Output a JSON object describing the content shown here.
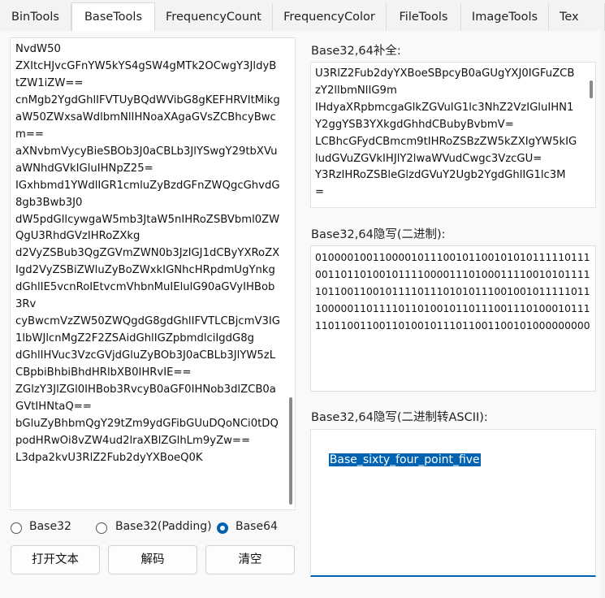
{
  "tabs": [
    {
      "label": "BinTools",
      "active": false
    },
    {
      "label": "BaseTools",
      "active": true
    },
    {
      "label": "FrequencyCount",
      "active": false
    },
    {
      "label": "FrequencyColor",
      "active": false
    },
    {
      "label": "FileTools",
      "active": false
    },
    {
      "label": "ImageTools",
      "active": false
    },
    {
      "label": "Tex",
      "active": false
    }
  ],
  "left": {
    "text": "NvdW50\nZXItcHJvcGFnYW5kYS4gSW4gMTk2OCwgY3JldyBtZW1iZW==\ncnMgb2YgdGhlIFVTUyBQdWVibG8gKEFHRVItMikgaW50ZWxsaWdlbmNlIHNoaXAgaGVsZCBhcyBwcm==\naXNvbmVycyBieSBOb3J0aCBLb3JlYSwgY29tbXVuaWNhdGVkIGluIHNpZ25=\nIGxhbmd1YWdlIGR1cmluZyBzdGFnZWQgcGhvdG8gb3Bwb3J0\ndW5pdGllcywgaW5mb3JtaW5nIHRoZSBVbml0ZWQgU3RhdGVzIHRoZXkg\nd2VyZSBub3QgZGVmZWN0b3JzIGJ1dCByYXRoZXIgd2VyZSBiZWluZyBoZWxkIGNhcHRpdmUgYnkgdGhlIE5vcnRoIEtvcmVhbnMuIElulG90aGVyIHBob3Rv\ncyBwcmVzZW50ZWQgdG8gdGhlIFVTLCBjcmV3IG1lbWJlcnMgZ2F2ZSAidGhlIGZpbmdlciIgdG8g\ndGhlIHVuc3VzcGVjdGluZyBOb3J0aCBLb3JlYW5zLCBpbiBhbiBhdHRlbXB0IHRvIE==\nZGlzY3JlZGl0IHBob3RvcyB0aGF0IHNob3dlZCB0aGVtIHNtaQ==\nbGluZyBhbmQgY29tZm9ydGFibGUuDQoNCi0tDQpodHRwOi8vZW4ud2lraXBlZGlhLm9yZw==\nL3dpa2kvU3RlZ2Fub2dyYXBoeQ0K"
  },
  "radios": [
    {
      "label": "Base32",
      "checked": false
    },
    {
      "label": "Base32(Padding)",
      "checked": false
    },
    {
      "label": "Base64",
      "checked": true
    }
  ],
  "buttons": {
    "open": "打开文本",
    "decode": "解码",
    "clear": "清空"
  },
  "panels": {
    "fill_label": "Base32,64补全:",
    "fill_text": "U3RlZ2Fub2dyYXBoeSBpcyB0aGUgYXJ0IGFuZCBzY2llbmNlIG9m\nIHdyaXRpbmcgaGlkZGVuIG1lc3NhZ2VzIGluIHN1Y2ggYSB3YXkgdGhhdCBubyBvbmV=\nLCBhcGFydCBmcm9tIHRoZSBzZW5kZXIgYW5kIGludGVuZGVkIHJlY2lwaWVudCwgc3VzcGU=\nY3RzIHRoZSBleGlzdGVuY2Ugb2YgdGhlIG1lc3M\n=",
    "binary_label": "Base32,64隐写(二进制):",
    "binary_text": "01000010011000010111001011001010101111101110011011010010111100001110100011110010101111101100110010111101110101011100100101111101110000011011110110100101101110011101000101111101100110011010010111011001100101000000000",
    "ascii_label": "Base32,64隐写(二进制转ASCII):",
    "ascii_text": "Base_sixty_four_point_five"
  }
}
